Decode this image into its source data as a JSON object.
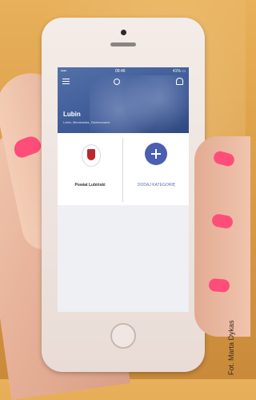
{
  "photo": {
    "credit": "Fot. Marta Dykas"
  },
  "app": {
    "status": {
      "left": "•••• ",
      "time": "09:46",
      "right": "41% ▭"
    },
    "header": {
      "title": "Lubin",
      "subtitle": "Lubin, Miedzianka, Zdzieszowice"
    },
    "tiles": {
      "left_label": "Powiat Lubiński",
      "right_label": "DODAJ KATEGORIĘ"
    },
    "colors": {
      "header": "#3e5a96",
      "accent": "#4a5fb0",
      "nail": "#ff4d7a"
    }
  }
}
